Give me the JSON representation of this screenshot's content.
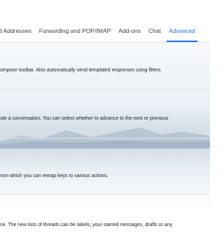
{
  "tabs": [
    {
      "label": "d Addresses"
    },
    {
      "label": "Forwarding and POP/IMAP"
    },
    {
      "label": "Add-ons"
    },
    {
      "label": "Chat"
    },
    {
      "label": "Advanced"
    }
  ],
  "active_tab": "Advanced",
  "settings": [
    {
      "description": "ompose toolbar. Also automatically send templated responses using filters."
    },
    {
      "description": "ute a conversation. You can select whether to advance to the next or previous"
    },
    {
      "description": "rom which you can remap keys to various actions."
    },
    {
      "description": "ce. The new lists of threads can be labels, your starred messages, drafts or any"
    }
  ],
  "colors": {
    "accent": "#1a73e8",
    "divider": "#e3e3e3",
    "text": "#202124"
  }
}
